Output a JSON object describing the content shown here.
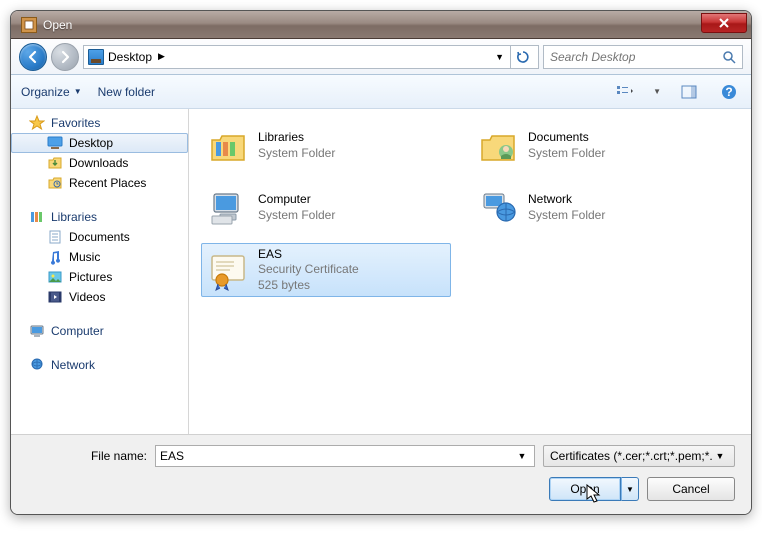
{
  "window": {
    "title": "Open"
  },
  "nav": {
    "crumb": "Desktop",
    "search_placeholder": "Search Desktop"
  },
  "toolbar": {
    "organize": "Organize",
    "newfolder": "New folder"
  },
  "sidebar": {
    "favorites": {
      "head": "Favorites",
      "items": [
        "Desktop",
        "Downloads",
        "Recent Places"
      ]
    },
    "libraries": {
      "head": "Libraries",
      "items": [
        "Documents",
        "Music",
        "Pictures",
        "Videos"
      ]
    },
    "computer": {
      "head": "Computer"
    },
    "network": {
      "head": "Network"
    }
  },
  "items": [
    {
      "name": "Libraries",
      "sub1": "System Folder",
      "sub2": ""
    },
    {
      "name": "Documents",
      "sub1": "System Folder",
      "sub2": ""
    },
    {
      "name": "Computer",
      "sub1": "System Folder",
      "sub2": ""
    },
    {
      "name": "Network",
      "sub1": "System Folder",
      "sub2": ""
    },
    {
      "name": "EAS",
      "sub1": "Security Certificate",
      "sub2": "525 bytes"
    }
  ],
  "bottom": {
    "fname_label": "File name:",
    "fname_value": "EAS",
    "filter": "Certificates (*.cer;*.crt;*.pem;*.p",
    "open": "Open",
    "cancel": "Cancel"
  }
}
